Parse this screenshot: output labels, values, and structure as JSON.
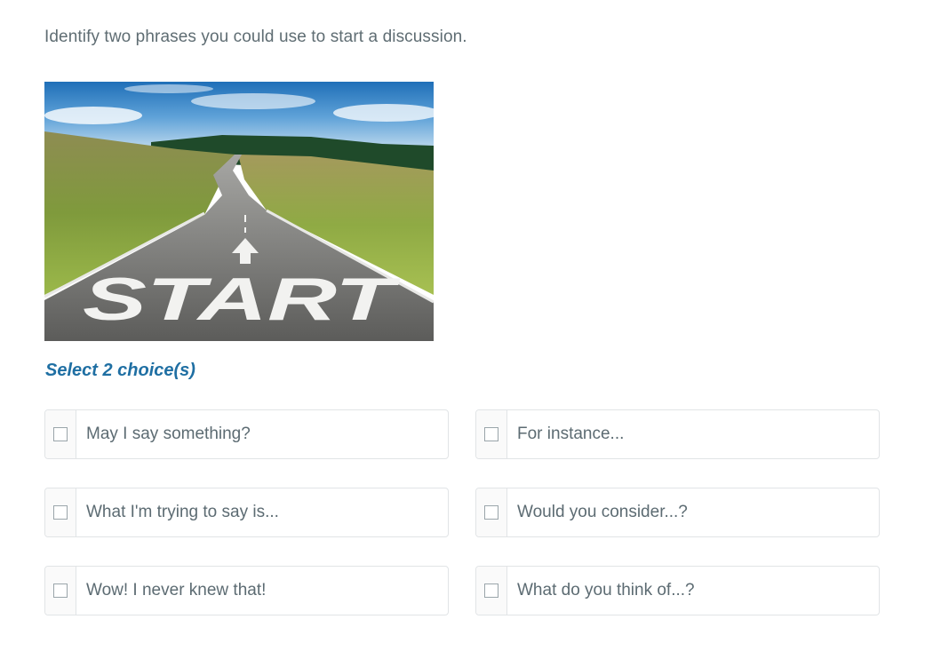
{
  "question": {
    "prompt": "Identify two phrases you could use to start a discussion."
  },
  "image": {
    "road_marking": "START"
  },
  "instruction": "Select 2 choice(s)",
  "choices": [
    {
      "label": "May I say something?",
      "checked": false
    },
    {
      "label": "For instance...",
      "checked": false
    },
    {
      "label": "What I'm trying to say is...",
      "checked": false
    },
    {
      "label": "Would you consider...?",
      "checked": false
    },
    {
      "label": "Wow! I never knew that!",
      "checked": false
    },
    {
      "label": "What do you think of...?",
      "checked": false
    }
  ],
  "colors": {
    "accent": "#1f6fa3",
    "text": "#5c6b72",
    "border": "#e1e4e6"
  }
}
